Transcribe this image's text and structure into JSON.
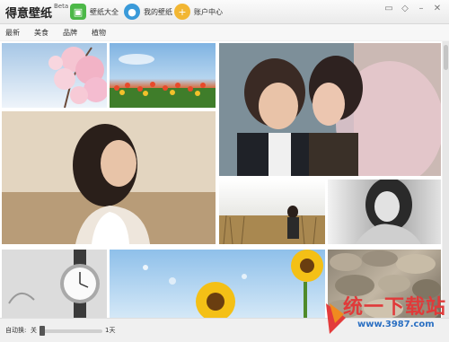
{
  "app": {
    "title": "得意壁纸",
    "badge": "Beta"
  },
  "nav": [
    {
      "label": "壁纸大全",
      "icon": "image-icon",
      "color": "#4cb848"
    },
    {
      "label": "我的壁纸",
      "icon": "user-icon",
      "color": "#3a9ad9"
    },
    {
      "label": "账户中心",
      "icon": "plus-icon",
      "color": "#f2b632"
    }
  ],
  "tabs": [
    "最新",
    "美食",
    "品牌",
    "植物"
  ],
  "gallery": {
    "tiles": [
      "cherry-blossom-sky",
      "tulip-field",
      "couple-portrait",
      "woman-portrait",
      "field-woman",
      "woman-bw-portrait",
      "wristwatch",
      "sunflowers-sky",
      "pebbles"
    ]
  },
  "footer": {
    "auto_change_label": "自动换:",
    "off_label": "关",
    "days_label": "1天",
    "interval_value": 0
  },
  "watermark": {
    "text": "统一下载站",
    "url": "www.3987.com"
  }
}
